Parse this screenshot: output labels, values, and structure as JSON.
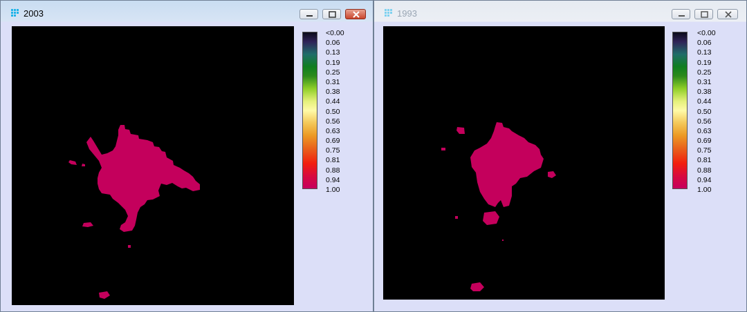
{
  "windows": [
    {
      "title": "2003",
      "active": true
    },
    {
      "title": "1993",
      "active": false
    }
  ],
  "legend": {
    "labels": [
      "<0.00",
      "0.06",
      "0.13",
      "0.19",
      "0.25",
      "0.31",
      "0.38",
      "0.44",
      "0.50",
      "0.56",
      "0.63",
      "0.69",
      "0.75",
      "0.81",
      "0.88",
      "0.94",
      "1.00"
    ]
  },
  "colors": {
    "urban": "#c4005c",
    "background": "#000000"
  },
  "icons": {
    "app": "grid-app-icon",
    "minimize": "minimize-icon",
    "maximize": "maximize-icon",
    "close": "close-icon"
  }
}
